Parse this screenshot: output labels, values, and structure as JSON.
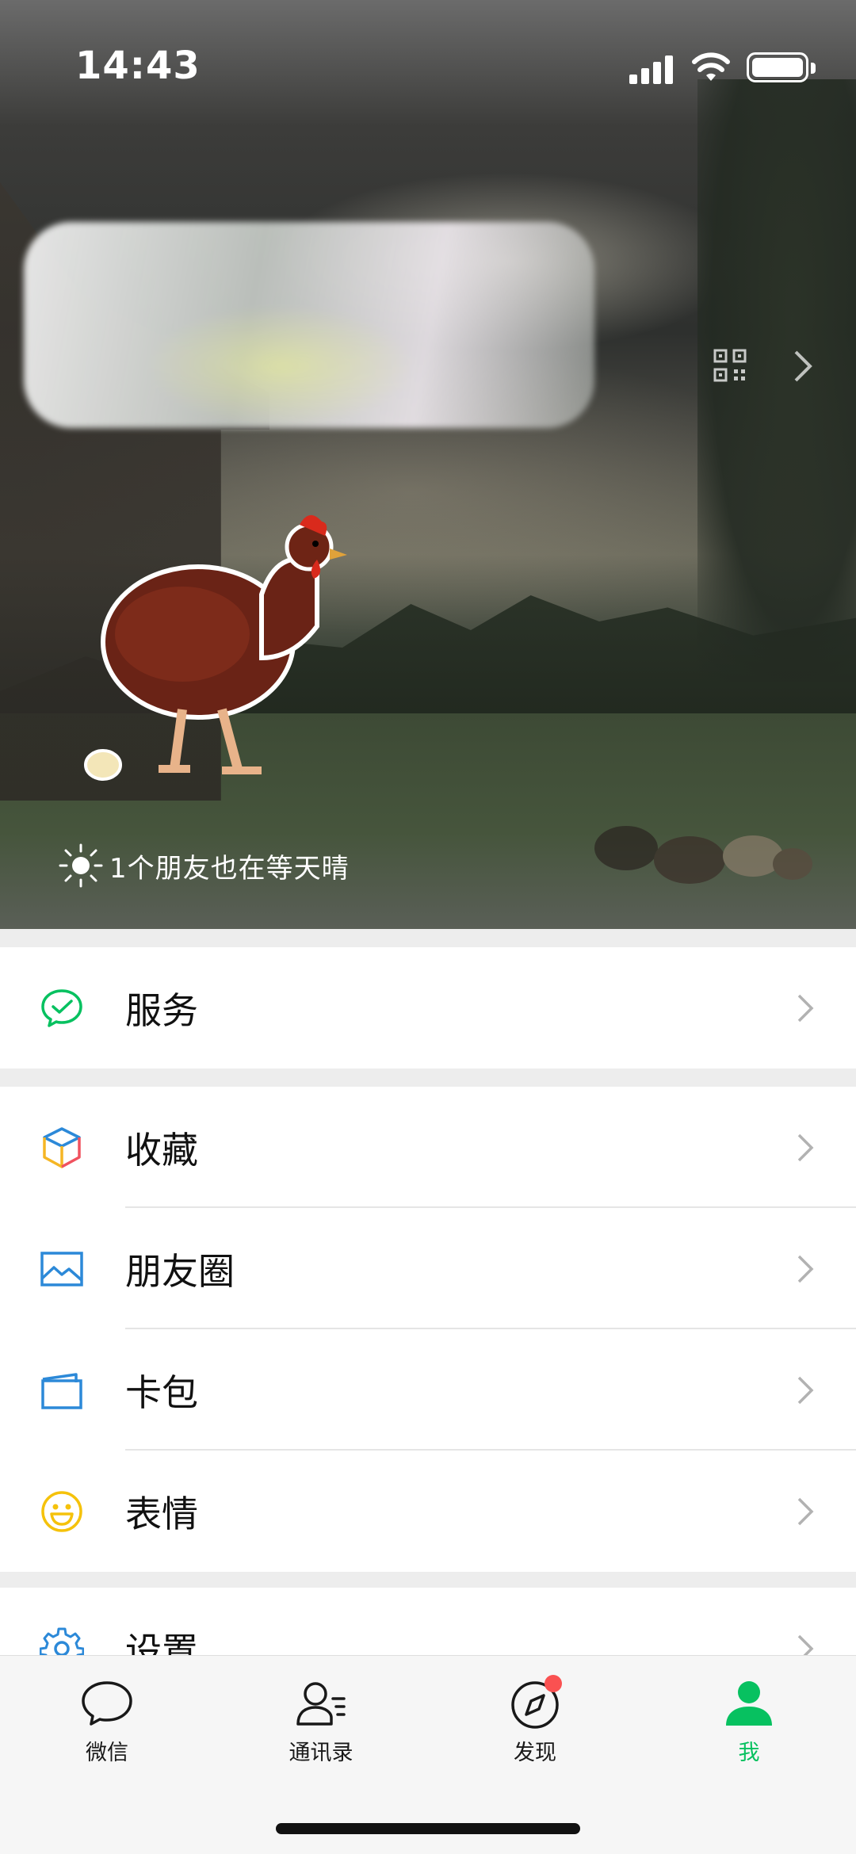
{
  "status_bar": {
    "time": "14:43"
  },
  "header": {
    "status_text": "1个朋友也在等天晴"
  },
  "menu": {
    "group1": [
      {
        "label": "服务",
        "icon": "wechat-pay-icon"
      }
    ],
    "group2": [
      {
        "label": "收藏",
        "icon": "favorites-cube-icon"
      },
      {
        "label": "朋友圈",
        "icon": "moments-image-icon"
      },
      {
        "label": "卡包",
        "icon": "card-wallet-icon"
      },
      {
        "label": "表情",
        "icon": "sticker-smile-icon"
      }
    ],
    "group3": [
      {
        "label": "设置",
        "icon": "gear-icon"
      }
    ]
  },
  "tabbar": {
    "tabs": [
      {
        "label": "微信",
        "icon": "chat-bubble-icon"
      },
      {
        "label": "通讯录",
        "icon": "contacts-icon"
      },
      {
        "label": "发现",
        "icon": "compass-icon"
      },
      {
        "label": "我",
        "icon": "person-icon"
      }
    ],
    "active_color": "#07c160",
    "badge_color": "#fa5151"
  }
}
